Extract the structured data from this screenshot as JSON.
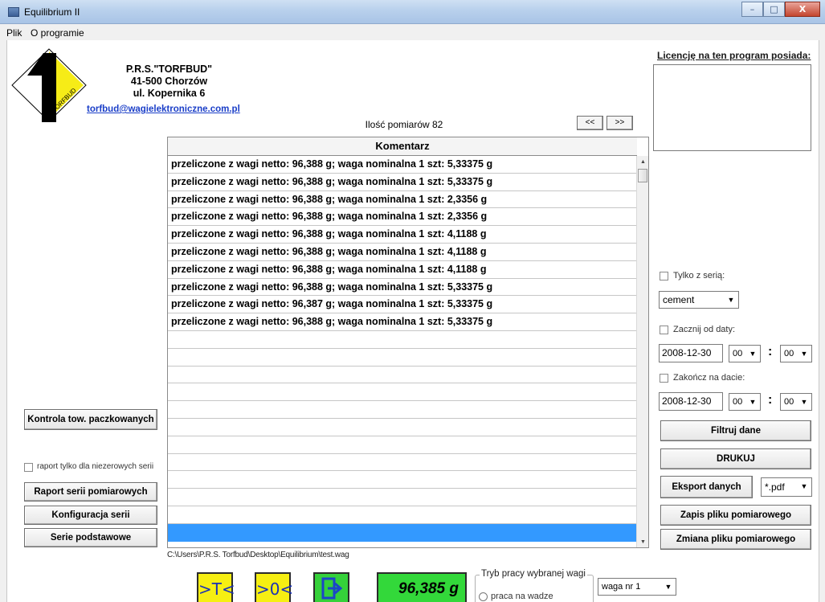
{
  "window": {
    "title": "Equilibrium II",
    "minimize": "–",
    "maximize": "□",
    "close": "X"
  },
  "menu": {
    "file": "Plik",
    "about": "O programie"
  },
  "company": {
    "name": "P.R.S.\"TORFBUD\"",
    "postal": "41-500 Chorzów",
    "street": "ul. Kopernika 6",
    "email": "torfbud@wagielektroniczne.com.pl",
    "logo_text": "TORFBUD"
  },
  "licence": {
    "label": "Licencję na ten program posiada:"
  },
  "measurements": {
    "count_label": "Ilość pomiarów 82",
    "prev": "<<",
    "next": ">>",
    "column_header": "Komentarz",
    "rows": [
      "przeliczone z wagi netto: 96,388 g;  waga nominalna 1 szt: 5,33375 g",
      "przeliczone z wagi netto: 96,388 g;  waga nominalna 1 szt: 5,33375 g",
      "przeliczone z wagi netto: 96,388 g;  waga nominalna 1 szt: 2,3356 g",
      "przeliczone z wagi netto: 96,388 g;  waga nominalna 1 szt: 2,3356 g",
      "przeliczone z wagi netto: 96,388 g;  waga nominalna 1 szt: 4,1188 g",
      "przeliczone z wagi netto: 96,388 g;  waga nominalna 1 szt: 4,1188 g",
      "przeliczone z wagi netto: 96,388 g;  waga nominalna 1 szt: 4,1188 g",
      "przeliczone z wagi netto: 96,388 g;  waga nominalna 1 szt: 5,33375 g",
      "przeliczone z wagi netto: 96,387 g;  waga nominalna 1 szt: 5,33375 g",
      "przeliczone z wagi netto: 96,388 g;  waga nominalna 1 szt: 5,33375 g"
    ],
    "file_path": "C:\\Users\\P.R.S. Torfbud\\Desktop\\Equilibrium\\test.wag"
  },
  "left_panel": {
    "packaged_control": "Kontrola tow. paczkowanych",
    "report_only_faulty": "raport tylko dla niezerowych serii",
    "series_report": "Raport serii pomiarowych",
    "series_config": "Konfiguracja serii",
    "base_series": "Serie podstawowe"
  },
  "right_panel": {
    "only_series": "Tylko z serią:",
    "series_value": "cement",
    "start_from_date": "Zacznij od daty:",
    "start_date": "2008-12-30",
    "start_hour": "00",
    "start_min": "00",
    "end_on_date": "Zakończ na dacie:",
    "end_date": "2008-12-30",
    "end_hour": "00",
    "end_min": "00",
    "colon": ":",
    "filter": "Filtruj dane",
    "print": "DRUKUJ",
    "export": "Eksport danych",
    "export_format": "*.pdf",
    "save_file": "Zapis pliku pomiarowego",
    "change_file": "Zmiana pliku pomiarowego"
  },
  "toolbar": {
    "tare": ">T<",
    "zero": ">0<",
    "weight": "96,385 g",
    "mode_group": "Tryb pracy wybranej wagi",
    "mode_option": "praca na wadze",
    "scale_select": "waga nr 1"
  },
  "colors": {
    "tool_yellow": "#f6ef12",
    "tool_green": "#35d13a",
    "selection": "#3399ff",
    "link": "#1a3ec8"
  }
}
